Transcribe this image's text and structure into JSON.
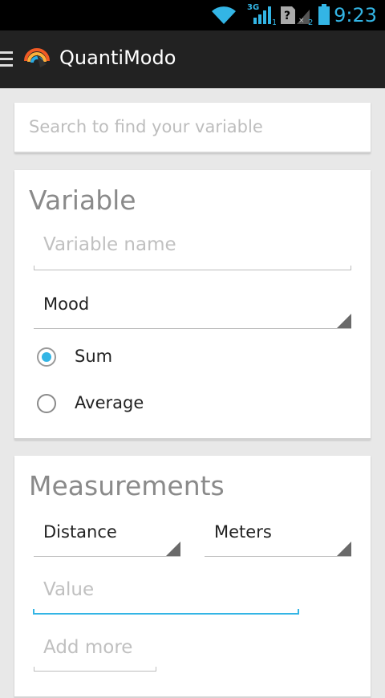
{
  "status_bar": {
    "time": "9:23",
    "icons": [
      "wifi-icon",
      "signal-3g-icon",
      "no-sim-icon",
      "battery-icon"
    ],
    "network_label": "3G"
  },
  "action_bar": {
    "title": "QuantiModo",
    "menu_icon": "menu-icon",
    "logo_icon": "quantimodo-logo-icon"
  },
  "search": {
    "placeholder": "Search to find your variable"
  },
  "variable_card": {
    "title": "Variable",
    "name_placeholder": "Variable name",
    "category_selected": "Mood",
    "options": [
      {
        "label": "Sum",
        "checked": true
      },
      {
        "label": "Average",
        "checked": false
      }
    ]
  },
  "measurements_card": {
    "title": "Measurements",
    "category_selected": "Distance",
    "unit_selected": "Meters",
    "value_placeholder": "Value",
    "add_more_placeholder": "Add more"
  },
  "colors": {
    "accent": "#33b5e5",
    "action_bar": "#222222",
    "background": "#e8e8e8"
  }
}
